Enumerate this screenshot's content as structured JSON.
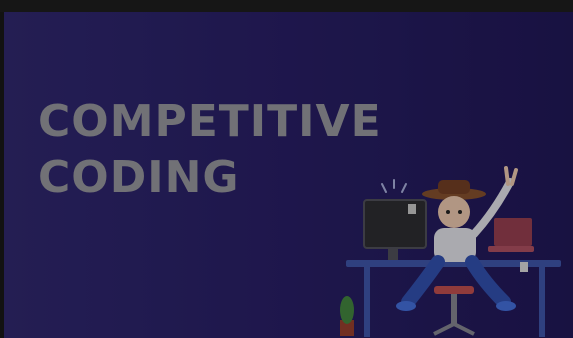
{
  "banner": {
    "title_line1": "COMPETITIVE",
    "title_line2": "CODING"
  },
  "illustration": {
    "subject": "person-at-desk-with-monitor-and-laptop"
  },
  "colors": {
    "background_start": "#2c2566",
    "background_end": "#1e1650",
    "title_text": "#8a8a90"
  }
}
